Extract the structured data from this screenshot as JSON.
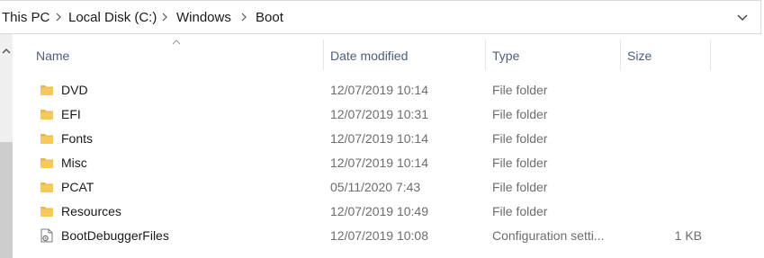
{
  "breadcrumb": [
    "This PC",
    "Local Disk (C:)",
    "Windows",
    "Boot"
  ],
  "columns": {
    "name": "Name",
    "date": "Date modified",
    "type": "Type",
    "size": "Size"
  },
  "rows": [
    {
      "name": "DVD",
      "date": "12/07/2019 10:14",
      "type": "File folder",
      "size": "",
      "icon": "folder-icon"
    },
    {
      "name": "EFI",
      "date": "12/07/2019 10:31",
      "type": "File folder",
      "size": "",
      "icon": "folder-icon"
    },
    {
      "name": "Fonts",
      "date": "12/07/2019 10:14",
      "type": "File folder",
      "size": "",
      "icon": "folder-icon"
    },
    {
      "name": "Misc",
      "date": "12/07/2019 10:14",
      "type": "File folder",
      "size": "",
      "icon": "folder-icon"
    },
    {
      "name": "PCAT",
      "date": "05/11/2020 7:43",
      "type": "File folder",
      "size": "",
      "icon": "folder-icon"
    },
    {
      "name": "Resources",
      "date": "12/07/2019 10:49",
      "type": "File folder",
      "size": "",
      "icon": "folder-icon"
    },
    {
      "name": "BootDebuggerFiles",
      "date": "12/07/2019 10:08",
      "type": "Configuration setti...",
      "size": "1 KB",
      "icon": "settings-file-icon"
    }
  ],
  "colors": {
    "folder": "#e8b84a",
    "header_text": "#4c607a",
    "secondary_text": "#6d6d6d"
  }
}
